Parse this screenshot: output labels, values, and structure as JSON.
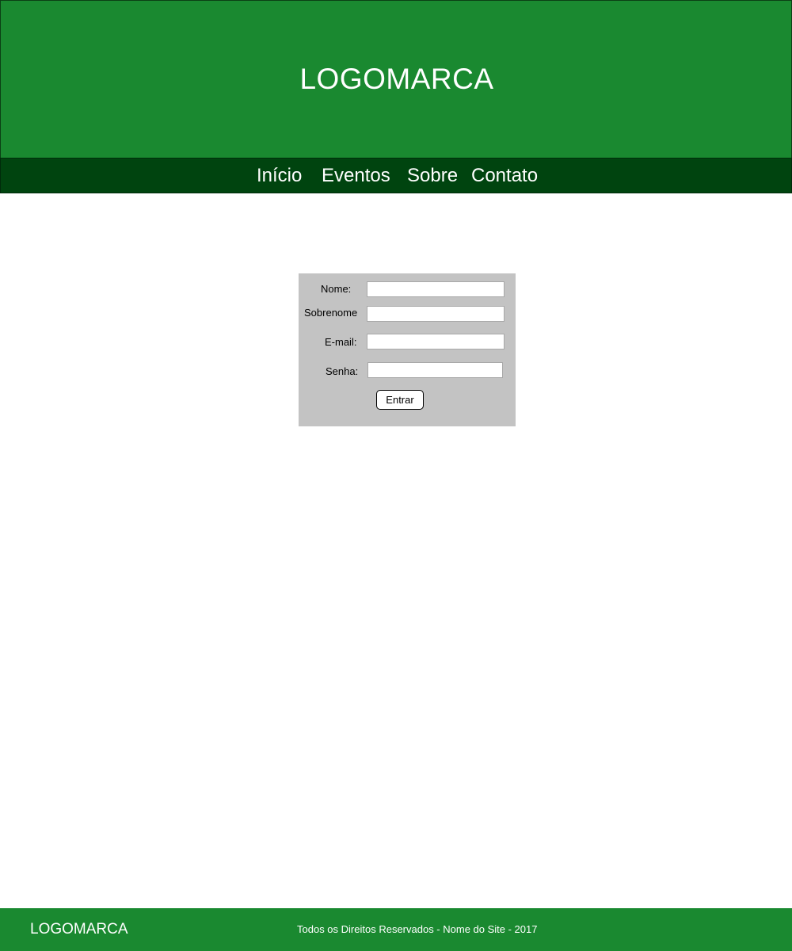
{
  "header": {
    "logo": "LOGOMARCA"
  },
  "nav": {
    "items": [
      {
        "label": "Início"
      },
      {
        "label": "Eventos"
      },
      {
        "label": "Sobre"
      },
      {
        "label": "Contato"
      }
    ]
  },
  "login_form": {
    "fields": [
      {
        "label": "Nome:",
        "value": ""
      },
      {
        "label": "Sobrenome",
        "value": ""
      },
      {
        "label": "E-mail:",
        "value": ""
      },
      {
        "label": "Senha:",
        "value": ""
      }
    ],
    "submit_label": "Entrar"
  },
  "footer": {
    "logo": "LOGOMARCA",
    "copyright": "Todos os Direitos Reservados - Nome do Site - 2017"
  },
  "colors": {
    "header_green": "#1a8930",
    "nav_dark_green": "#00440f",
    "form_background": "#c3c3c3"
  }
}
